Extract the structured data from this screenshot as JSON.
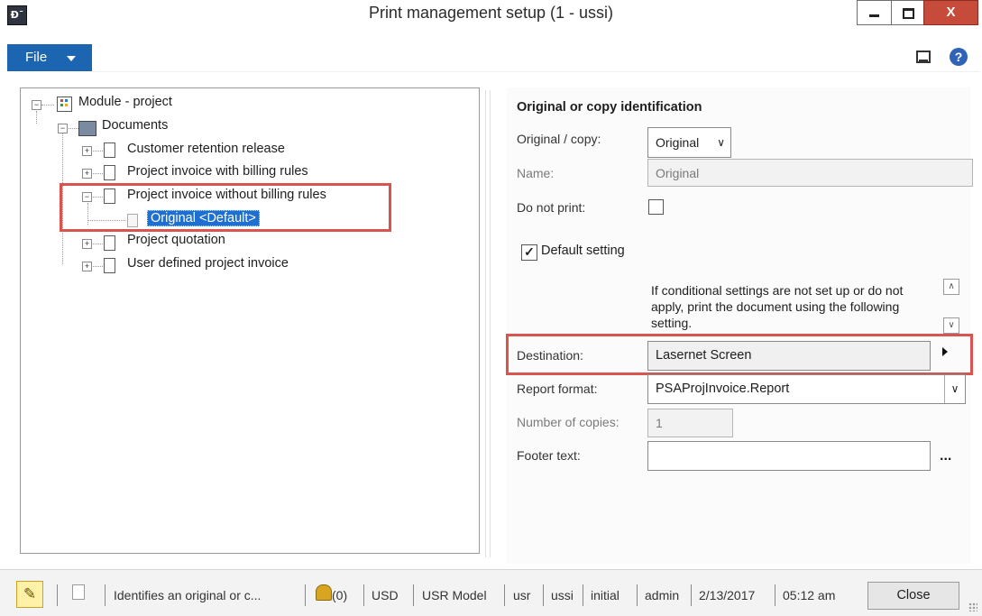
{
  "window": {
    "title": "Print management setup (1 - ussi)",
    "app_icon": "Ð¯",
    "close_glyph": "X"
  },
  "menu": {
    "file_label": "File",
    "icons": [
      "layout-icon",
      "help-icon"
    ],
    "help_glyph": "?"
  },
  "tree": {
    "root": "Module - project",
    "group": "Documents",
    "items": [
      "Customer retention release",
      "Project invoice with billing rules",
      "Project invoice without billing rules",
      "Project quotation",
      "User defined project invoice"
    ],
    "selected_child": "Original <Default>"
  },
  "form": {
    "section_title": "Original or copy identification",
    "original_copy_label": "Original / copy:",
    "original_copy_value": "Original",
    "name_label": "Name:",
    "name_value": "Original",
    "do_not_print_label": "Do not print:",
    "do_not_print_checked": false,
    "default_setting_label": "Default setting",
    "default_setting_checked": true,
    "info_text": "If conditional settings are not set up or do not apply, print the document using the following setting.",
    "destination_label": "Destination:",
    "destination_value": "Lasernet Screen",
    "report_format_label": "Report format:",
    "report_format_value": "PSAProjInvoice.Report",
    "copies_label": "Number of copies:",
    "copies_value": "1",
    "footer_label": "Footer text:",
    "footer_value": "",
    "footer_more": "..."
  },
  "status": {
    "help_text": "Identifies an original or c...",
    "alerts": "(0)",
    "currency": "USD",
    "model": "USR Model",
    "layer": "usr",
    "company": "ussi",
    "partition": "initial",
    "user": "admin",
    "date": "2/13/2017",
    "time": "05:12 am",
    "close_label": "Close"
  },
  "colors": {
    "accent": "#1c66b1",
    "selection": "#1f6fd1",
    "highlight_box": "#d9534f",
    "close_button": "#c74b3a"
  }
}
